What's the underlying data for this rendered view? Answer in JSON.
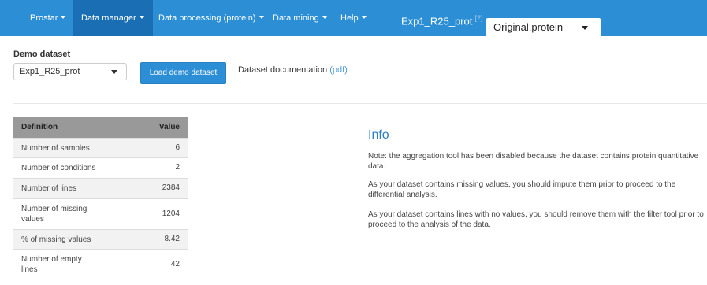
{
  "nav": {
    "items": [
      {
        "label": "Prostar",
        "active": false
      },
      {
        "label": "Data manager",
        "active": true
      },
      {
        "label": "Data processing (protein)",
        "active": false
      },
      {
        "label": "Data mining",
        "active": false
      },
      {
        "label": "Help",
        "active": false
      }
    ],
    "dataset_title": "Exp1_R25_prot",
    "help_marker": "[?]",
    "dataset_select": "Original.protein"
  },
  "demo": {
    "label": "Demo dataset",
    "selected": "Exp1_R25_prot",
    "load_button": "Load demo dataset",
    "doc_text": "Dataset documentation",
    "doc_link": "(pdf)"
  },
  "table": {
    "headers": [
      "Definition",
      "Value"
    ],
    "rows": [
      {
        "definition_lines": [
          "Number of samples"
        ],
        "value": "6"
      },
      {
        "definition_lines": [
          "Number of conditions"
        ],
        "value": "2"
      },
      {
        "definition_lines": [
          "Number of lines"
        ],
        "value": "2384"
      },
      {
        "definition_lines": [
          "Number of missing",
          "values"
        ],
        "value": "1204"
      },
      {
        "definition_lines": [
          "% of missing values"
        ],
        "value": "8.42"
      },
      {
        "definition_lines": [
          "Number of empty",
          "lines"
        ],
        "value": "42"
      }
    ]
  },
  "info": {
    "title": "Info",
    "paragraphs": [
      [
        "Note: the aggregation tool has been disabled because the dataset contains protein quantitative",
        "data."
      ],
      [
        "As your dataset contains missing values, you should impute them prior to proceed to the",
        "differential analysis."
      ],
      [
        "As your dataset contains lines with no values, you should remove them with the filter tool prior to",
        "proceed to the analysis of the data."
      ]
    ]
  },
  "colors": {
    "navbar": "#2c8fd6",
    "navbar_active": "#1a6fb4",
    "table_header": "#999999",
    "info_title": "#2c7fc0",
    "link": "#4d9ad8"
  }
}
